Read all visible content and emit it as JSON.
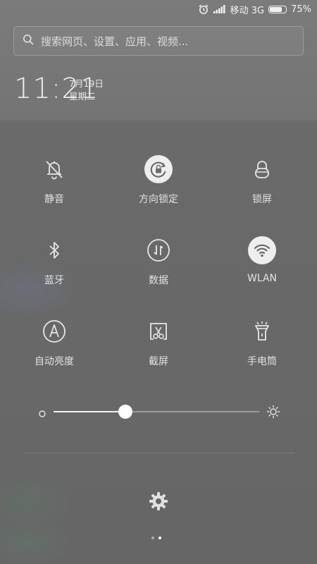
{
  "status_bar": {
    "carrier": "移动 3G",
    "battery_percent": "75%",
    "battery_level": 0.75,
    "icons": [
      "alarm-icon",
      "signal-icon",
      "battery-icon"
    ]
  },
  "search": {
    "placeholder": "搜索网页、设置、应用、视频...",
    "icon": "search-icon"
  },
  "clock": {
    "time": "11:21",
    "date": "7月19日",
    "weekday": "星期二"
  },
  "toggles": [
    {
      "label": "静音",
      "icon": "bell-off-icon",
      "active": false
    },
    {
      "label": "方向锁定",
      "icon": "rotation-lock-icon",
      "active": true
    },
    {
      "label": "锁屏",
      "icon": "lock-icon",
      "active": false
    },
    {
      "label": "蓝牙",
      "icon": "bluetooth-icon",
      "active": false
    },
    {
      "label": "数据",
      "icon": "mobile-data-icon",
      "active": false
    },
    {
      "label": "WLAN",
      "icon": "wifi-icon",
      "active": true
    },
    {
      "label": "自动亮度",
      "icon": "auto-brightness-icon",
      "active": false
    },
    {
      "label": "截屏",
      "icon": "screenshot-icon",
      "active": false
    },
    {
      "label": "手电筒",
      "icon": "flashlight-icon",
      "active": false
    }
  ],
  "brightness": {
    "level": 0.35,
    "icons": [
      "brightness-low-icon",
      "brightness-high-icon"
    ]
  },
  "pager": {
    "pages": 2,
    "current": 2
  },
  "colors": {
    "active_toggle_bg": "#eeeeee",
    "icon_color": "#e6e6e6"
  }
}
